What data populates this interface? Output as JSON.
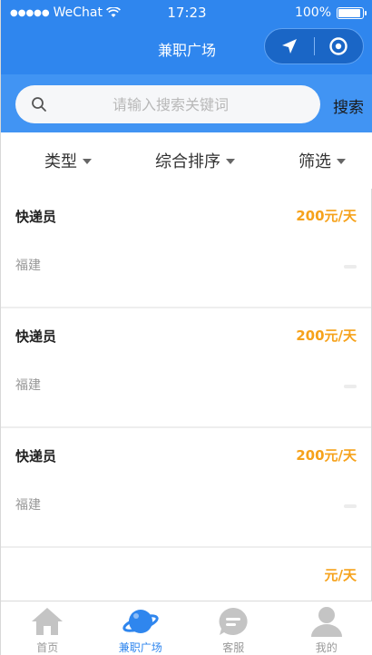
{
  "status": {
    "carrier": "WeChat",
    "time": "17:23",
    "battery": "100%"
  },
  "nav": {
    "title": "兼职广场"
  },
  "search": {
    "placeholder": "请输入搜索关键词",
    "button": "搜索"
  },
  "filters": [
    {
      "label": "类型"
    },
    {
      "label": "综合排序"
    },
    {
      "label": "筛选"
    }
  ],
  "jobs": [
    {
      "title": "快递员",
      "salary": "200元/天",
      "location": "福建"
    },
    {
      "title": "快递员",
      "salary": "200元/天",
      "location": "福建"
    },
    {
      "title": "快递员",
      "salary": "200元/天",
      "location": "福建"
    },
    {
      "title": "",
      "salary": "元/天",
      "location": ""
    }
  ],
  "tabs": [
    {
      "label": "首页",
      "icon": "home-icon"
    },
    {
      "label": "兼职广场",
      "icon": "planet-icon"
    },
    {
      "label": "客服",
      "icon": "chat-icon"
    },
    {
      "label": "我的",
      "icon": "user-icon"
    }
  ],
  "colors": {
    "primary": "#2f86ee",
    "salary": "#f6a21b",
    "inactive": "#999999"
  }
}
